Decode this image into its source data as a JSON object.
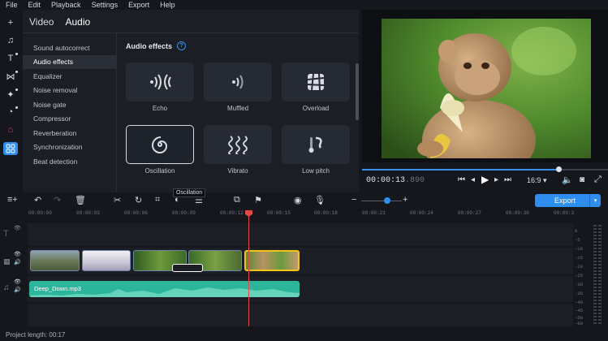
{
  "menu": [
    "File",
    "Edit",
    "Playback",
    "Settings",
    "Export",
    "Help"
  ],
  "tabs": {
    "video": "Video",
    "audio": "Audio"
  },
  "categories": [
    "Sound autocorrect",
    "Audio effects",
    "Equalizer",
    "Noise removal",
    "Noise gate",
    "Compressor",
    "Reverberation",
    "Synchronization",
    "Beat detection"
  ],
  "effects_header": "Audio effects",
  "effects": [
    {
      "label": "Echo",
      "icon": "echo-icon"
    },
    {
      "label": "Muffled",
      "icon": "muffled-icon"
    },
    {
      "label": "Overload",
      "icon": "overload-icon"
    },
    {
      "label": "Oscillation",
      "icon": "oscillation-icon"
    },
    {
      "label": "Vibrato",
      "icon": "vibrato-icon"
    },
    {
      "label": "Low pitch",
      "icon": "low-pitch-icon"
    }
  ],
  "player": {
    "timecode_main": "00:00:13",
    "timecode_ms": ".890",
    "aspect": "16:9",
    "progress": 0.8
  },
  "toolbar": {
    "tooltip": "Oscillation",
    "export_label": "Export"
  },
  "ruler": [
    "00:00:00",
    "00:00:03",
    "00:00:06",
    "00:00:09",
    "00:00:12",
    "00:00:15",
    "00:00:18",
    "00:00:21",
    "00:00:24",
    "00:00:27",
    "00:00:30",
    "00:00:3"
  ],
  "audio_clip": {
    "name": "Deep_Down.mp3"
  },
  "meter_ticks": [
    "0",
    "-5",
    "-10",
    "-15",
    "-20",
    "-25",
    "-30",
    "-35",
    "-40",
    "-45",
    "-50",
    "-60"
  ],
  "status": {
    "project_length": "Project length: 00:17"
  },
  "colors": {
    "accent": "#2d8ef0",
    "audio": "#2bb59a",
    "playhead": "#e24a4a",
    "selected_clip": "#f0c419"
  }
}
